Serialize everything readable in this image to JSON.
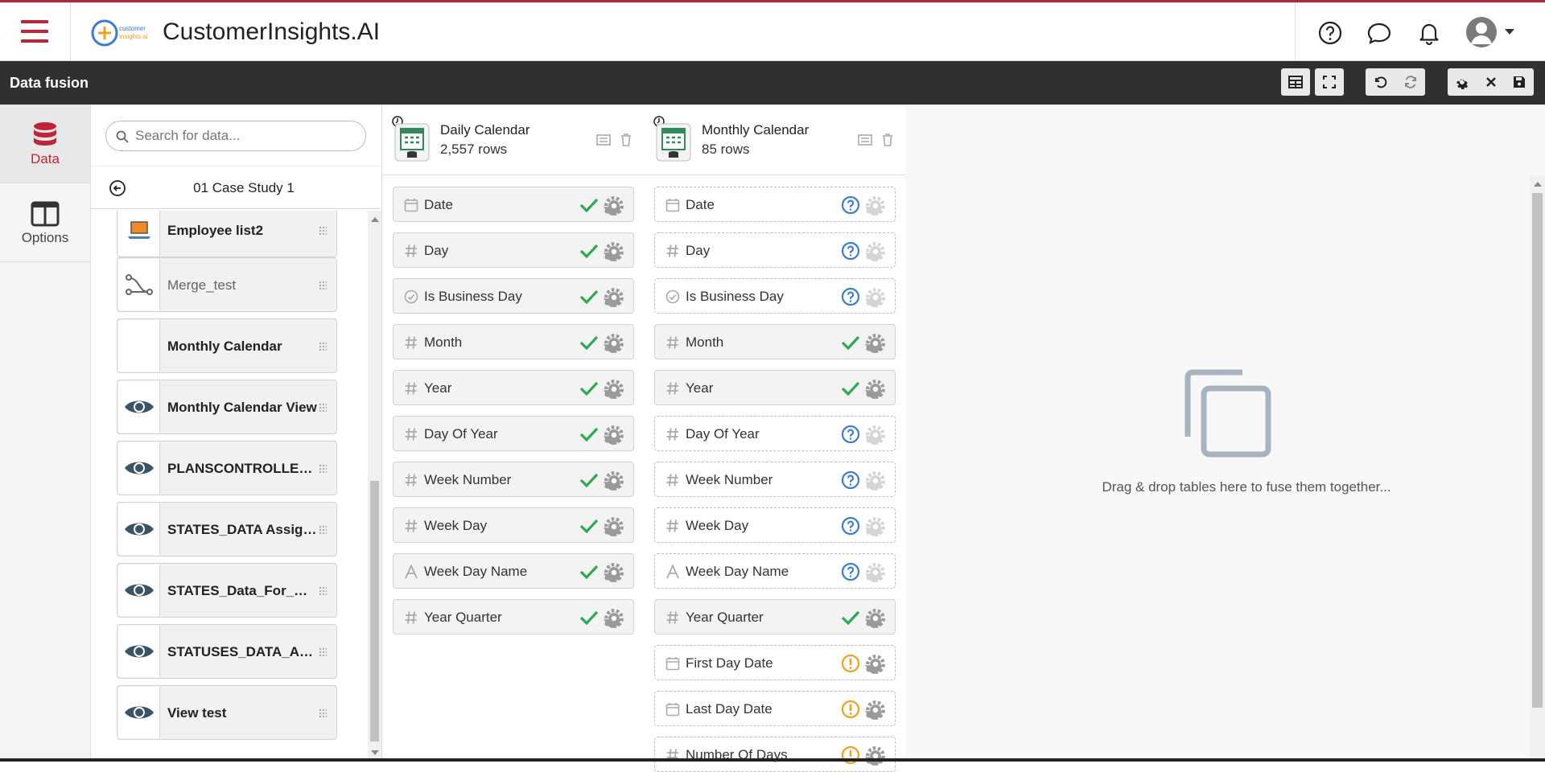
{
  "header": {
    "app_title": "CustomerInsights.AI",
    "logo_text": "customer insights.ai"
  },
  "toolbar": {
    "title": "Data fusion"
  },
  "leftnav": {
    "items": [
      {
        "label": "Data"
      },
      {
        "label": "Options"
      }
    ]
  },
  "datapanel": {
    "search_placeholder": "Search for data...",
    "breadcrumb": "01 Case Study 1",
    "items": [
      {
        "name": "Employee list2",
        "icon": "laptop-icon"
      },
      {
        "name": "Merge_test",
        "icon": "merge-icon"
      },
      {
        "name": "Monthly Calendar",
        "icon": "blank"
      },
      {
        "name": "Monthly Calendar View",
        "icon": "eye-icon"
      },
      {
        "name": "PLANSCONTROLLER_D...",
        "icon": "eye-icon"
      },
      {
        "name": "STATES_DATA Assign...",
        "icon": "eye-icon"
      },
      {
        "name": "STATES_Data_For_MAT...",
        "icon": "eye-icon"
      },
      {
        "name": "STATUSES_DATA_Assig...",
        "icon": "eye-icon"
      },
      {
        "name": "View test",
        "icon": "eye-icon"
      }
    ]
  },
  "tables": [
    {
      "title": "Daily Calendar",
      "rows": "2,557 rows",
      "fields": [
        {
          "name": "Date",
          "type": "date",
          "status": "ok"
        },
        {
          "name": "Day",
          "type": "number",
          "status": "ok"
        },
        {
          "name": "Is Business Day",
          "type": "bool",
          "status": "ok"
        },
        {
          "name": "Month",
          "type": "number",
          "status": "ok"
        },
        {
          "name": "Year",
          "type": "number",
          "status": "ok"
        },
        {
          "name": "Day Of Year",
          "type": "number",
          "status": "ok"
        },
        {
          "name": "Week Number",
          "type": "number",
          "status": "ok"
        },
        {
          "name": "Week Day",
          "type": "number",
          "status": "ok"
        },
        {
          "name": "Week Day Name",
          "type": "text",
          "status": "ok"
        },
        {
          "name": "Year Quarter",
          "type": "number",
          "status": "ok"
        }
      ]
    },
    {
      "title": "Monthly Calendar",
      "rows": "85 rows",
      "fields": [
        {
          "name": "Date",
          "type": "date",
          "status": "question"
        },
        {
          "name": "Day",
          "type": "number",
          "status": "question"
        },
        {
          "name": "Is Business Day",
          "type": "bool",
          "status": "question"
        },
        {
          "name": "Month",
          "type": "number",
          "status": "ok"
        },
        {
          "name": "Year",
          "type": "number",
          "status": "ok"
        },
        {
          "name": "Day Of Year",
          "type": "number",
          "status": "question"
        },
        {
          "name": "Week Number",
          "type": "number",
          "status": "question"
        },
        {
          "name": "Week Day",
          "type": "number",
          "status": "question"
        },
        {
          "name": "Week Day Name",
          "type": "text",
          "status": "question"
        },
        {
          "name": "Year Quarter",
          "type": "number",
          "status": "ok"
        },
        {
          "name": "First Day Date",
          "type": "date",
          "status": "warning"
        },
        {
          "name": "Last Day Date",
          "type": "date",
          "status": "warning"
        },
        {
          "name": "Number Of Days",
          "type": "number",
          "status": "warning"
        }
      ]
    }
  ],
  "dropzone": {
    "text": "Drag & drop tables here to fuse them together..."
  },
  "colors": {
    "brand_red": "#c0243a",
    "ok_green": "#2daa4f",
    "question_blue": "#3a7bd5",
    "warning_orange": "#f0a020"
  }
}
